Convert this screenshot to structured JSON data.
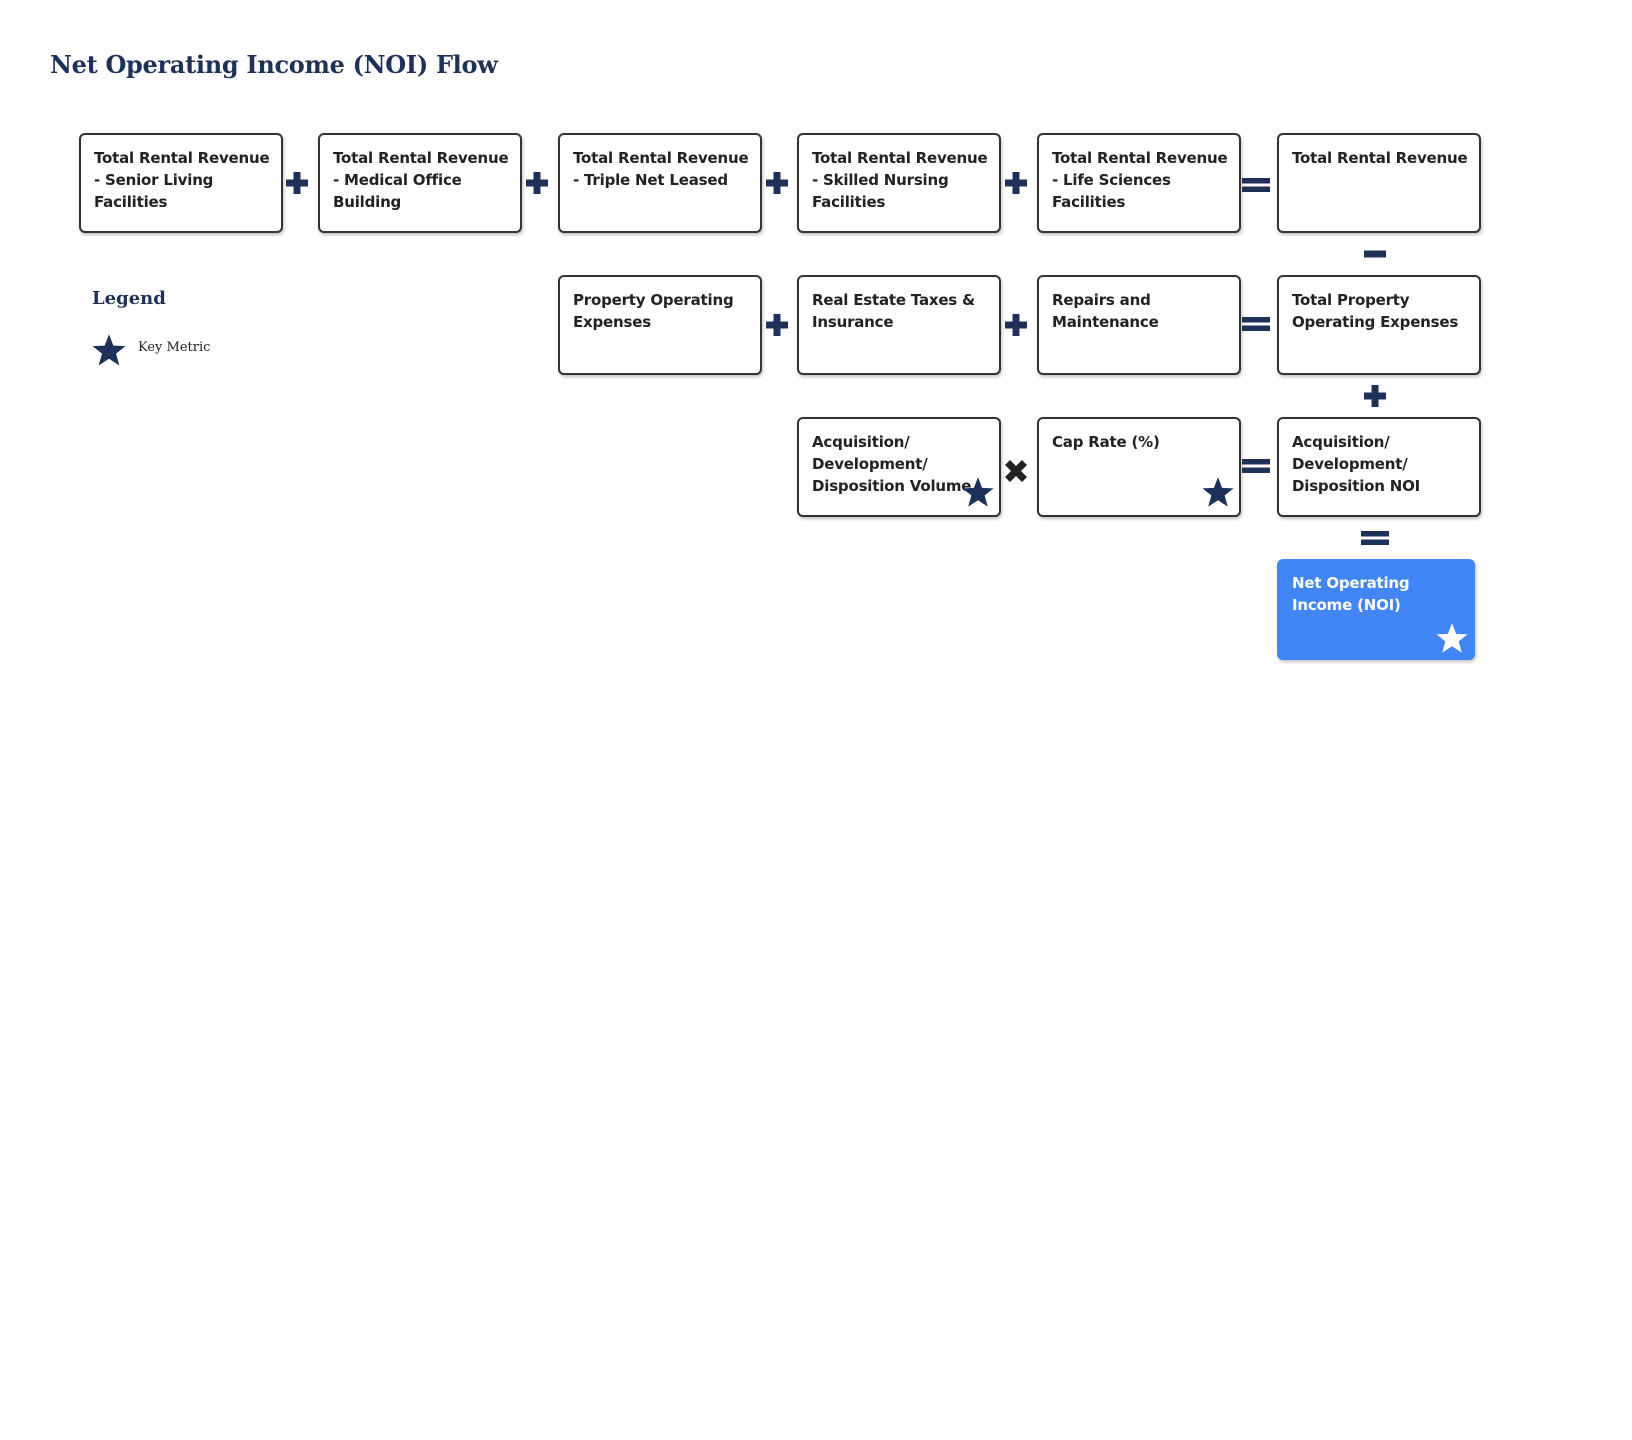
{
  "title": "Net Operating Income (NOI) Flow",
  "legend": {
    "title": "Legend",
    "items": [
      {
        "icon": "star-icon",
        "label": "Key Metric"
      }
    ]
  },
  "colors": {
    "primary_navy": "#1f3158",
    "result_blue": "#4285f4",
    "box_border": "#333333"
  },
  "nodes": {
    "rev_senior": {
      "label": "Total Rental Revenue - Senior Living Facilities",
      "key_metric": false
    },
    "rev_mob": {
      "label": "Total Rental Revenue - Medical Office Building",
      "key_metric": false
    },
    "rev_nnn": {
      "label": "Total Rental Revenue - Triple Net Leased",
      "key_metric": false
    },
    "rev_snf": {
      "label": "Total Rental Revenue - Skilled Nursing Facilities",
      "key_metric": false
    },
    "rev_life": {
      "label": "Total Rental Revenue - Life Sciences Facilities",
      "key_metric": false
    },
    "rev_total": {
      "label": "Total Rental Revenue",
      "key_metric": false
    },
    "opex": {
      "label": "Property Operating Expenses",
      "key_metric": false
    },
    "taxes": {
      "label": "Real Estate Taxes & Insurance",
      "key_metric": false
    },
    "repairs": {
      "label": "Repairs and Maintenance",
      "key_metric": false
    },
    "opex_total": {
      "label": "Total Property Operating Expenses",
      "key_metric": false
    },
    "add_volume": {
      "label": "Acquisition/ Development/ Disposition Volume",
      "key_metric": true
    },
    "cap_rate": {
      "label": "Cap Rate (%)",
      "key_metric": true
    },
    "add_noi": {
      "label": "Acquisition/ Development/ Disposition NOI",
      "key_metric": false
    },
    "noi": {
      "label": "Net Operating Income (NOI)",
      "key_metric": true
    }
  },
  "operators": [
    {
      "between": [
        "rev_senior",
        "rev_mob"
      ],
      "op": "plus"
    },
    {
      "between": [
        "rev_mob",
        "rev_nnn"
      ],
      "op": "plus"
    },
    {
      "between": [
        "rev_nnn",
        "rev_snf"
      ],
      "op": "plus"
    },
    {
      "between": [
        "rev_snf",
        "rev_life"
      ],
      "op": "plus"
    },
    {
      "between": [
        "rev_life",
        "rev_total"
      ],
      "op": "equals"
    },
    {
      "between": [
        "rev_total",
        "opex_total"
      ],
      "op": "minus"
    },
    {
      "between": [
        "opex",
        "taxes"
      ],
      "op": "plus"
    },
    {
      "between": [
        "taxes",
        "repairs"
      ],
      "op": "plus"
    },
    {
      "between": [
        "repairs",
        "opex_total"
      ],
      "op": "equals"
    },
    {
      "between": [
        "opex_total",
        "add_noi"
      ],
      "op": "plus"
    },
    {
      "between": [
        "add_volume",
        "cap_rate"
      ],
      "op": "times"
    },
    {
      "between": [
        "cap_rate",
        "add_noi"
      ],
      "op": "equals"
    },
    {
      "between": [
        "add_noi",
        "noi"
      ],
      "op": "equals"
    }
  ]
}
